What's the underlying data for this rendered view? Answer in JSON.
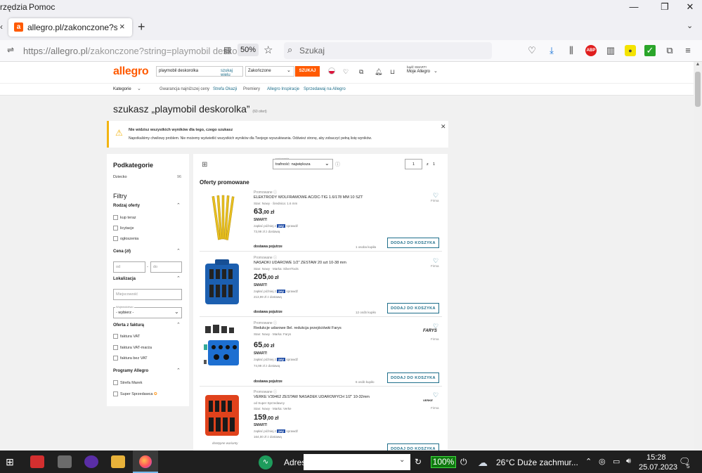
{
  "menubar": {
    "items": [
      "rzędzia",
      "Pomoc"
    ]
  },
  "browser": {
    "tab_title": "allegro.pl/zakonczone?string=p",
    "url_prefix": "https://allegro.pl",
    "url_rest": "/zakonczone?string=playmobil deskorolka",
    "zoom": "50%",
    "search_placeholder": "Szukaj",
    "new_tab": "+",
    "tab_close": "×"
  },
  "header": {
    "logo": "allegro",
    "search_value": "playmobil deskorolka",
    "search_link": "szukaj wielu",
    "scope": "Zakończone",
    "search_button": "SZUKAJ",
    "account_top": "bądź SMART!",
    "account_label": "Moje Allegro"
  },
  "subnav": [
    "Kategorie",
    "Gwarancja najniższej ceny",
    "Strefa Okazji",
    "Premiery",
    "Allegro Inspiracje",
    "Sprzedawaj na Allegro"
  ],
  "page": {
    "title": "szukasz „playmobil deskorolka”",
    "count": "(60 ofert)"
  },
  "alert": {
    "heading": "Nie widzisz wszystkich wyników dla tego, czego szukasz",
    "body": "Napotkaliśmy chwilowy problem. Nie możemy wyświetlić wszystkich wyników dla Twojego wyszukiwania. Odśwież stronę, aby zobaczyć pełną listę wyników."
  },
  "sidebar": {
    "subcat_title": "Podkategorie",
    "subcat_name": "Dziecko",
    "subcat_count": "96",
    "filters_title": "Filtry",
    "offer_type_head": "Rodzaj oferty",
    "offer_types": [
      "kup teraz",
      "licytacje",
      "ogłoszenia"
    ],
    "price_head": "Cena (zł)",
    "price_from": "od",
    "price_to": "do",
    "price_sep": "-",
    "location_head": "Lokalizacja",
    "city_placeholder": "Miejscowość",
    "voivodeship_label": "Województwo",
    "voivodeship_value": "- wybierz -",
    "invoice_head": "Oferta z fakturą",
    "invoice_items": [
      "faktura VAT",
      "faktura VAT-marża",
      "faktura bez VAT"
    ],
    "programs_head": "Programy Allegro",
    "programs": [
      "Strefa Marek",
      "Super Sprzedawca"
    ]
  },
  "results": {
    "sort_label": "sortowanie",
    "sort_value": "trafność: największa",
    "page_current": "1",
    "page_of": "z",
    "page_total": "1",
    "promoted_heading": "Oferty promowane",
    "promo_tag": "Promowane",
    "buy_button": "DODAJ DO KOSZYKA",
    "firma": "Firma",
    "delivery": "dostawa pojutrze",
    "smart": "SMART!",
    "pay_pre": "zapłać później z",
    "pay_brand": "pay",
    "pay_post": "sprawdź",
    "offers": [
      {
        "title": "ELEKTRODY WOLFRAMOWE AC/DC-TIG 1.6/178 MM 10 SZT",
        "meta": "Stan: Nowy · Średnica: 1.6 mm",
        "price_int": "63",
        "price_dec": ",00 zł",
        "with_delivery": "73,99 zł z dostawą",
        "buyers": "1 osoba kupiła",
        "brand": ""
      },
      {
        "title": "NASADKI UDAROWE 1/2\" ZESTAW 20 szt 10-38 mm",
        "meta": "Stan: Nowy · Marka: SilverTools",
        "price_int": "205",
        "price_dec": ",00 zł",
        "with_delivery": "213,99 zł z dostawą",
        "buyers": "12 osób kupiło",
        "brand": ""
      },
      {
        "title": "Redukcje udarowe 8el. redukcja przejściówki Farys",
        "meta": "Stan: Nowy · Marka: Farys",
        "price_int": "65",
        "price_dec": ",00 zł",
        "with_delivery": "74,99 zł z dostawą",
        "buyers": "6 osób kupiło",
        "brand": "FARYS"
      },
      {
        "title": "VERKE V39462 ZESTAW NASADEK UDAROWYCH 1/2\" 10-32mm",
        "meta": "Stan: Nowy · Marka: Verke",
        "seller": "od Super Sprzedawcy",
        "price_int": "159",
        "price_dec": ",00 zł",
        "with_delivery": "164,00 zł z dostawą",
        "buyers": "",
        "brand": "VERKE",
        "warranty": "dostępne warianty"
      }
    ]
  },
  "taskbar": {
    "address_label": "Adres",
    "battery": "100%",
    "weather": "26°C  Duże zachmur...",
    "time": "15:28",
    "date": "25.07.2023",
    "notif_count": "5"
  },
  "colors": {
    "accent": "#ff5a00",
    "teal": "#1f6f8b",
    "warning": "#f2b411",
    "taskbar": "#1f1f1f"
  }
}
